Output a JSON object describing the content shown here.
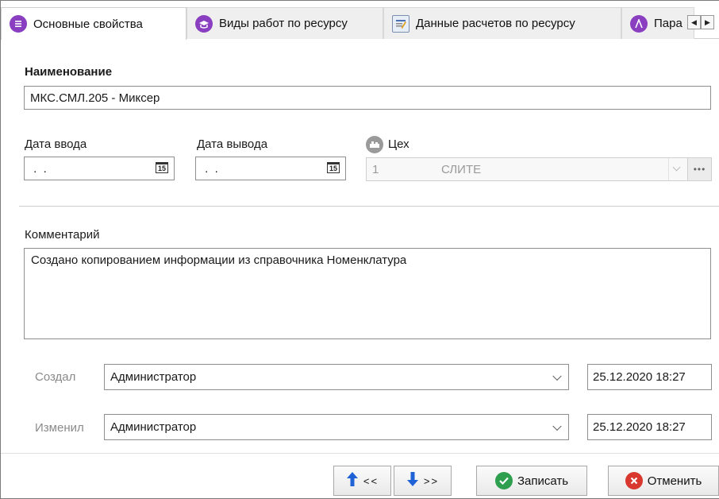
{
  "tabs": [
    {
      "label": "Основные свойства",
      "icon": "properties-icon",
      "active": true
    },
    {
      "label": "Виды работ по ресурсу",
      "icon": "work-types-icon"
    },
    {
      "label": "Данные расчетов по ресурсу",
      "icon": "calc-data-icon"
    },
    {
      "label": "Пара",
      "icon": "params-icon"
    }
  ],
  "form": {
    "name_label": "Наименование",
    "name_value": "МКС.СМЛ.205 - Миксер",
    "date_in_label": "Дата ввода",
    "date_in_value": " .  .",
    "date_out_label": "Дата вывода",
    "date_out_value": " .  .",
    "calendar_glyph": "15",
    "workshop_label": "Цех",
    "workshop_code": "1",
    "workshop_name": "СЛИТЕ",
    "comment_label": "Комментарий",
    "comment_value": "Создано копированием информации из справочника Номенклатура",
    "created_label": "Создал",
    "created_by": "Администратор",
    "created_at": "25.12.2020 18:27",
    "modified_label": "Изменил",
    "modified_by": "Администратор",
    "modified_at": "25.12.2020 18:27"
  },
  "buttons": {
    "prev": "<<",
    "next": ">>",
    "save": "Записать",
    "cancel": "Отменить"
  },
  "colors": {
    "accent": "#1e62d6",
    "save_icon": "#2e9e4f",
    "cancel_icon": "#d9382f",
    "tab_icon_purple": "#8a3fc0"
  }
}
